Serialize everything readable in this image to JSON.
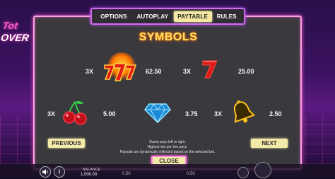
{
  "background": {
    "logo_line1": "Tot",
    "logo_line2": "OVER"
  },
  "tabs": [
    {
      "label": "OPTIONS",
      "active": false
    },
    {
      "label": "AUTOPLAY",
      "active": false
    },
    {
      "label": "PAYTABLE",
      "active": true
    },
    {
      "label": "RULES",
      "active": false
    }
  ],
  "title": "SYMBOLS",
  "symbols": [
    {
      "icon": "triple-seven-icon",
      "multiplier": "3X",
      "payout": "62.50"
    },
    {
      "icon": "seven-icon",
      "multiplier": "3X",
      "payout": "25.00"
    },
    {
      "icon": "cherries-icon",
      "multiplier": "3X",
      "payout": "5.00"
    },
    {
      "icon": "diamond-icon",
      "multiplier": "3X",
      "payout": "3.75"
    },
    {
      "icon": "bell-icon",
      "multiplier": "3X",
      "payout": "2.50"
    }
  ],
  "info_lines": [
    "Game pays left to right.",
    "Highest win per line pays.",
    "Payouts are dynamically reflected based on the selected bet."
  ],
  "buttons": {
    "previous": "PREVIOUS",
    "next": "NEXT",
    "close": "CLOSE"
  },
  "bottom_bar": {
    "balance_label": "BALANCE",
    "balance_value": "1,000.00",
    "stake_left": "0.50",
    "stake_right": "0.50"
  },
  "colors": {
    "modal_border": "#ffa2e6",
    "tab_border": "#d46af0",
    "button_bg": "#f3e9a8",
    "title": "#ffe26a"
  }
}
